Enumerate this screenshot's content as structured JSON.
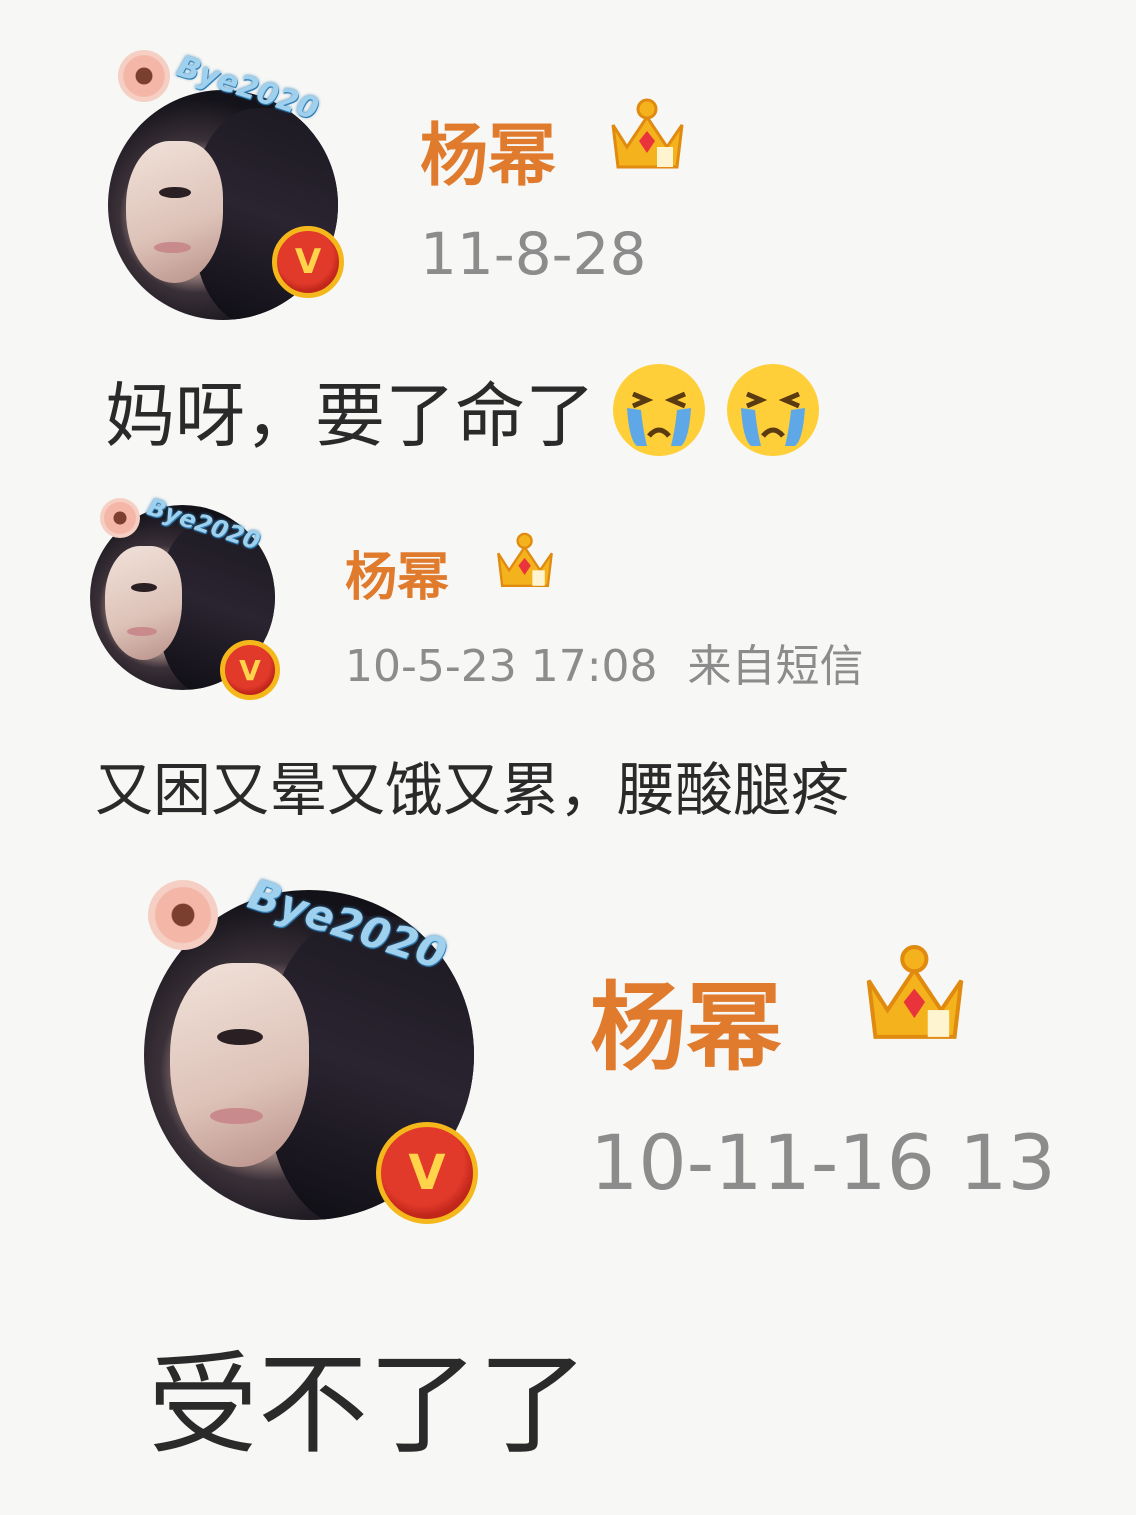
{
  "posts": [
    {
      "avatar_tag": "Bye2020",
      "verified_badge": "V",
      "username": "杨幂",
      "crown_icon": "crown-icon",
      "timestamp": "11-8-28",
      "source": "",
      "content": "妈呀，要了命了",
      "emojis": [
        "crying-face-emoji",
        "crying-face-emoji"
      ]
    },
    {
      "avatar_tag": "Bye2020",
      "verified_badge": "V",
      "username": "杨幂",
      "crown_icon": "crown-icon",
      "timestamp": "10-5-23 17:08",
      "source": "来自短信",
      "content": "又困又晕又饿又累，腰酸腿疼",
      "emojis": []
    },
    {
      "avatar_tag": "Bye2020",
      "verified_badge": "V",
      "username": "杨幂",
      "crown_icon": "crown-icon",
      "timestamp": "10-11-16 13",
      "source": "",
      "content": "受不了了",
      "emojis": []
    }
  ],
  "colors": {
    "username": "#e07b2e",
    "meta": "#8c8c8c",
    "content": "#2a2a2a",
    "background": "#f7f7f5"
  }
}
